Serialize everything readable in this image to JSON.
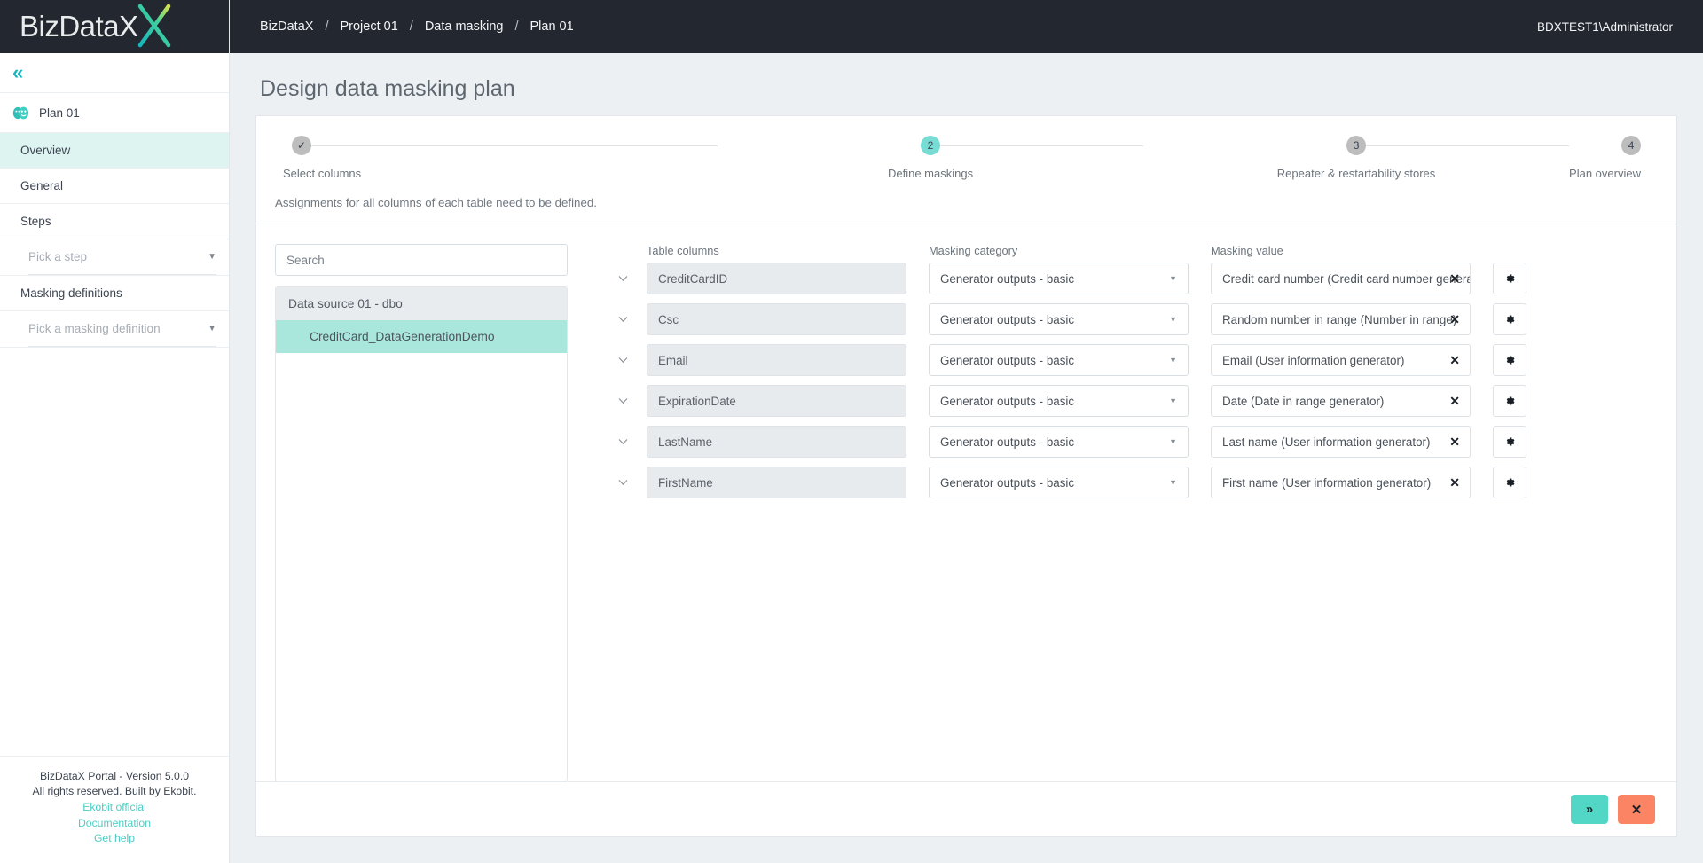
{
  "brand": {
    "name": "BizDataX",
    "logo_x_icon": "logo-x-icon"
  },
  "sidebar": {
    "collapse_icon": "double-chevron-left-icon",
    "plan": {
      "icon": "theater-masks-icon",
      "label": "Plan 01"
    },
    "items": [
      {
        "label": "Overview",
        "active": true
      },
      {
        "label": "General",
        "active": false
      },
      {
        "label": "Steps",
        "active": false
      }
    ],
    "step_picker": {
      "placeholder": "Pick a step",
      "caret_icon": "chevron-down-icon"
    },
    "masking_definitions_label": "Masking definitions",
    "masking_picker": {
      "placeholder": "Pick a masking definition",
      "caret_icon": "chevron-down-icon"
    },
    "footer": {
      "version": "BizDataX Portal - Version 5.0.0",
      "rights": "All rights reserved. Built by Ekobit.",
      "links": [
        "Ekobit official",
        "Documentation",
        "Get help"
      ]
    }
  },
  "topbar": {
    "breadcrumb": [
      "BizDataX",
      "Project 01",
      "Data masking",
      "Plan 01"
    ],
    "separator": "/",
    "user": "BDXTEST1\\Administrator"
  },
  "page": {
    "title": "Design data masking plan"
  },
  "stepper": {
    "steps": [
      {
        "marker": "✓",
        "label": "Select columns",
        "state": "done"
      },
      {
        "marker": "2",
        "label": "Define maskings",
        "state": "current"
      },
      {
        "marker": "3",
        "label": "Repeater & restartability stores",
        "state": "upcoming"
      },
      {
        "marker": "4",
        "label": "Plan overview",
        "state": "upcoming"
      }
    ]
  },
  "hint": "Assignments for all columns of each table need to be defined.",
  "search": {
    "placeholder": "Search",
    "value": ""
  },
  "tree": {
    "data_source": "Data source 01 - dbo",
    "table": "CreditCard_DataGenerationDemo"
  },
  "grid": {
    "headers": {
      "columns": "Table columns",
      "category": "Masking category",
      "value": "Masking value"
    },
    "expand_icon": "chevron-down-icon",
    "caret_icon": "chevron-down-icon",
    "clear_icon": "close-x-icon",
    "settings_icon": "gear-icon",
    "rows": [
      {
        "column": "CreditCardID",
        "category": "Generator outputs - basic",
        "value": "Credit card number (Credit card number generator)"
      },
      {
        "column": "Csc",
        "category": "Generator outputs - basic",
        "value": "Random number in range (Number in range)"
      },
      {
        "column": "Email",
        "category": "Generator outputs - basic",
        "value": "Email (User information generator)"
      },
      {
        "column": "ExpirationDate",
        "category": "Generator outputs - basic",
        "value": "Date (Date in range generator)"
      },
      {
        "column": "LastName",
        "category": "Generator outputs - basic",
        "value": "Last name (User information generator)"
      },
      {
        "column": "FirstName",
        "category": "Generator outputs - basic",
        "value": "First name (User information generator)"
      }
    ]
  },
  "actions": {
    "next": {
      "icon": "double-chevron-right-icon",
      "glyph": "»"
    },
    "cancel": {
      "icon": "close-x-icon",
      "glyph": "✕"
    }
  },
  "colors": {
    "brand_teal": "#4ecdc4",
    "dark_bar": "#23272f",
    "active_nav": "#ddf4f1",
    "selected_table": "#a9e7dd",
    "next_button": "#52d6c6",
    "cancel_button": "#fb8464",
    "step_current": "#76dcd4",
    "step_inactive": "#bdbdbd"
  }
}
